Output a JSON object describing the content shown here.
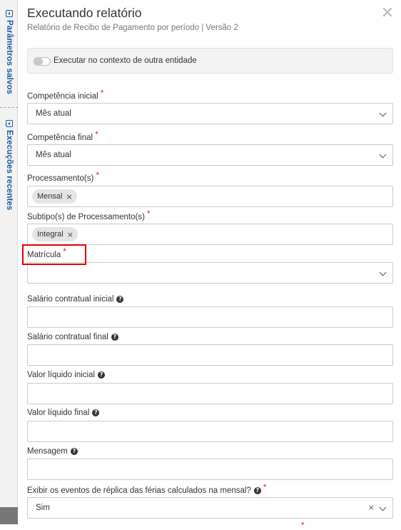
{
  "sidebar": {
    "tabs": [
      {
        "label": "Parâmetros salvos"
      },
      {
        "label": "Execuções recentes"
      }
    ]
  },
  "dialog": {
    "title": "Executando relatório",
    "subtitle": "Relatório de Recibo de Pagamento por período | Versão 2",
    "context_toggle": {
      "label": "Executar no contexto de outra entidade",
      "on": false
    }
  },
  "form": {
    "required_mark": "*",
    "help_glyph": "?",
    "remove_glyph": "×",
    "competencia_inicial": {
      "label": "Competência inicial",
      "value": "Mês atual"
    },
    "competencia_final": {
      "label": "Competência final",
      "value": "Mês atual"
    },
    "processamentos": {
      "label": "Processamento(s)",
      "chips": [
        "Mensal"
      ]
    },
    "subtipos": {
      "label": "Subtipo(s) de Processamento(s)",
      "chips": [
        "Integral"
      ]
    },
    "matricula": {
      "label": "Matrícula",
      "value": ""
    },
    "salario_inicial": {
      "label": "Salário contratual inicial",
      "value": ""
    },
    "salario_final": {
      "label": "Salário contratual final",
      "value": ""
    },
    "liquido_inicial": {
      "label": "Valor líquido inicial",
      "value": ""
    },
    "liquido_final": {
      "label": "Valor líquido final",
      "value": ""
    },
    "mensagem": {
      "label": "Mensagem",
      "value": ""
    },
    "replica_ferias": {
      "label": "Exibir os eventos de réplica das férias calculados na mensal?",
      "value": "Sim"
    }
  },
  "colors": {
    "accent": "#1e5aa0",
    "required": "#d9261c",
    "highlight": "#e00000"
  }
}
